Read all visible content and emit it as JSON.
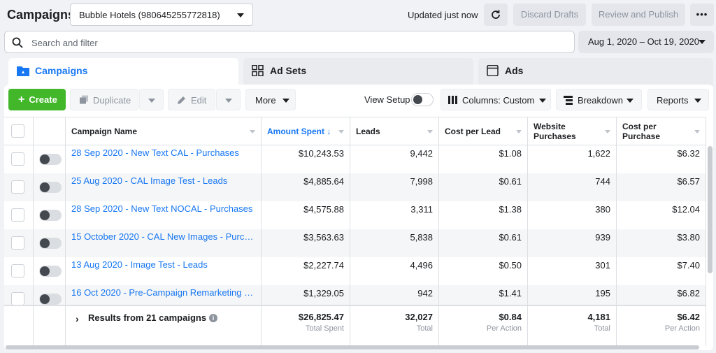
{
  "header": {
    "title": "Campaigns",
    "account": "Bubble Hotels (980645255772818)",
    "status": "Updated just now",
    "discard_label": "Discard Drafts",
    "publish_label": "Review and Publish",
    "more_label": "•••"
  },
  "search": {
    "placeholder": "Search and filter",
    "value": ""
  },
  "date_range": "Aug 1, 2020 – Oct 19, 2020",
  "tabs": [
    {
      "label": "Campaigns"
    },
    {
      "label": "Ad Sets"
    },
    {
      "label": "Ads"
    }
  ],
  "toolbar": {
    "create_label": "Create",
    "duplicate_label": "Duplicate",
    "edit_label": "Edit",
    "more_label": "More",
    "view_setup_label": "View Setup",
    "columns_label": "Columns: Custom",
    "breakdown_label": "Breakdown",
    "reports_label": "Reports"
  },
  "table": {
    "columns": [
      "Campaign Name",
      "Amount Spent",
      "Leads",
      "Cost per Lead",
      "Website Purchases",
      "Cost per Purchase"
    ],
    "sort_arrow": "↓",
    "rows": [
      {
        "name": "28 Sep 2020 - New Text CAL - Purchases",
        "spent": "$10,243.53",
        "leads": "9,442",
        "cpl": "$1.08",
        "purchases": "1,622",
        "cpp": "$6.32"
      },
      {
        "name": "25 Aug 2020 - CAL Image Test - Leads",
        "spent": "$4,885.64",
        "leads": "7,998",
        "cpl": "$0.61",
        "purchases": "744",
        "cpp": "$6.57"
      },
      {
        "name": "28 Sep 2020 - New Text NOCAL - Purchases",
        "spent": "$4,575.88",
        "leads": "3,311",
        "cpl": "$1.38",
        "purchases": "380",
        "cpp": "$12.04"
      },
      {
        "name": "15 October 2020 - CAL New Images - Purcha...",
        "spent": "$3,563.63",
        "leads": "5,838",
        "cpl": "$0.61",
        "purchases": "939",
        "cpp": "$3.80"
      },
      {
        "name": "13 Aug 2020 - Image Test - Leads",
        "spent": "$2,227.74",
        "leads": "4,496",
        "cpl": "$0.50",
        "purchases": "301",
        "cpp": "$7.40"
      },
      {
        "name": "16 Oct 2020 - Pre-Campaign Remarketing - P...",
        "spent": "$1,329.05",
        "leads": "942",
        "cpl": "$1.41",
        "purchases": "195",
        "cpp": "$6.82"
      }
    ],
    "totals": {
      "label": "Results from 21 campaigns",
      "spent": "$26,825.47",
      "spent_sub": "Total Spent",
      "leads": "32,027",
      "leads_sub": "Total",
      "cpl": "$0.84",
      "cpl_sub": "Per Action",
      "purchases": "4,181",
      "purchases_sub": "Total",
      "cpp": "$6.42",
      "cpp_sub": "Per Action"
    }
  },
  "colors": {
    "accent": "#1877f2",
    "create": "#42b72a"
  }
}
